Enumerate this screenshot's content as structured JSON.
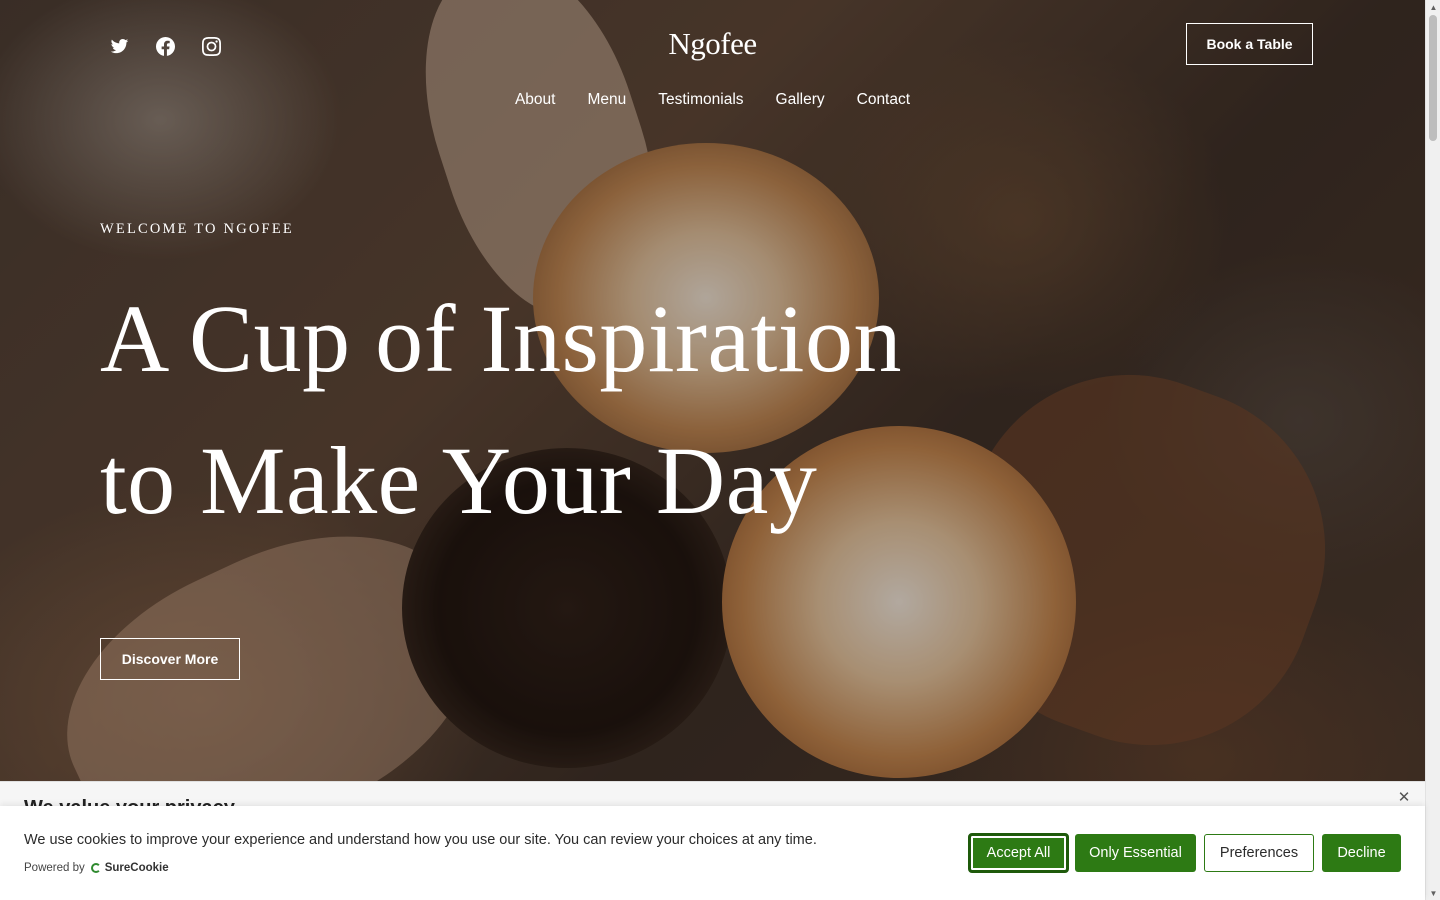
{
  "header": {
    "logo": "Ngofee",
    "book_button": "Book a Table",
    "socials": [
      {
        "icon": "twitter-icon"
      },
      {
        "icon": "facebook-icon"
      },
      {
        "icon": "instagram-icon"
      }
    ],
    "nav": [
      "About",
      "Menu",
      "Testimonials",
      "Gallery",
      "Contact"
    ]
  },
  "hero": {
    "eyebrow": "WELCOME TO NGOFEE",
    "headline_line1": "A Cup of Inspiration",
    "headline_line2": "to Make Your Day",
    "cta": "Discover More"
  },
  "cookie": {
    "title": "We value your privacy",
    "message": "We use cookies to improve your experience and understand how you use our site. You can review your choices at any time.",
    "powered_by": "Powered by",
    "brand": "SureCookie",
    "buttons": {
      "accept": "Accept All",
      "essential": "Only Essential",
      "preferences": "Preferences",
      "decline": "Decline"
    },
    "close_icon": "close-icon",
    "accent_color": "#2d7a14"
  },
  "colors": {
    "text_on_hero": "#ffffff",
    "button_green": "#2d7a14"
  }
}
